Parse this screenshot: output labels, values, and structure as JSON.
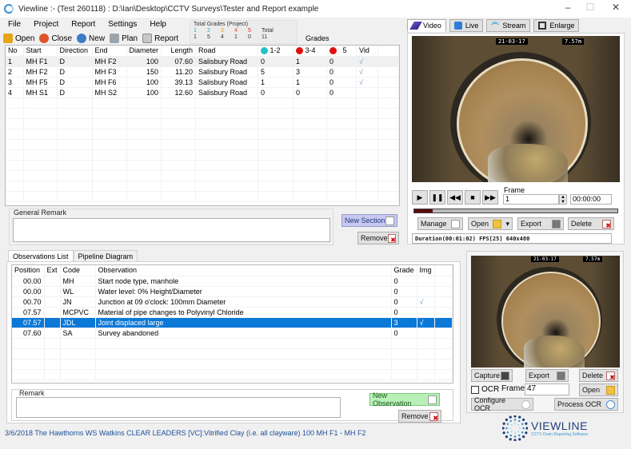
{
  "window": {
    "title": "Viewline :- (Test 260118) : D:\\Ian\\Desktop\\CCTV Surveys\\Tester and Report example",
    "controls": {
      "minimize": "–",
      "maximize": "☐",
      "close": "✕"
    }
  },
  "menu": [
    "File",
    "Project",
    "Report",
    "Settings",
    "Help"
  ],
  "toolbar": [
    {
      "label": "Open",
      "icon": "folder-open-icon",
      "color": "#e8a317"
    },
    {
      "label": "Close",
      "icon": "close-circle-icon",
      "color": "#e0522a"
    },
    {
      "label": "New",
      "icon": "new-globe-icon",
      "color": "#3a7dc9"
    },
    {
      "label": "Plan",
      "icon": "plan-map-icon",
      "color": "#9aa4ad"
    },
    {
      "label": "Report",
      "icon": "report-doc-icon",
      "color": "#8a8a8a"
    }
  ],
  "total_grades": {
    "title": "Total Grades (Project)",
    "headers": [
      "1",
      "2",
      "3",
      "4",
      "5",
      "Total"
    ],
    "header_colors": [
      "#3fa0c8",
      "#29b0c6",
      "#e0a020",
      "#e04848",
      "#e02020",
      "#333333"
    ],
    "values": [
      "1",
      "5",
      "4",
      "1",
      "0",
      "11"
    ]
  },
  "grades_label": "Grades",
  "sections": {
    "columns": [
      "No",
      "Start",
      "Direction",
      "End",
      "Diameter",
      "Length",
      "Road",
      "1-2",
      "3-4",
      "5",
      "Vid"
    ],
    "grade_dot_colors": [
      "#27c0c8",
      "#e01010",
      "#e01010"
    ],
    "rows": [
      {
        "no": "1",
        "start": "MH F1",
        "direction": "D",
        "end": "MH F2",
        "diameter": "100",
        "length": "07.60",
        "road": "Salisbury Road",
        "g12": "0",
        "g34": "1",
        "g5": "0",
        "vid": "√",
        "selected": true
      },
      {
        "no": "2",
        "start": "MH F2",
        "direction": "D",
        "end": "MH F3",
        "diameter": "150",
        "length": "11.20",
        "road": "Salisbury Road",
        "g12": "5",
        "g34": "3",
        "g5": "0",
        "vid": "√",
        "selected": false
      },
      {
        "no": "3",
        "start": "MH F5",
        "direction": "D",
        "end": "MH F6",
        "diameter": "100",
        "length": "39.13",
        "road": "Salisbury Road",
        "g12": "1",
        "g34": "1",
        "g5": "0",
        "vid": "√",
        "selected": false
      },
      {
        "no": "4",
        "start": "MH S1",
        "direction": "D",
        "end": "MH S2",
        "diameter": "100",
        "length": "12.60",
        "road": "Salisbury Road",
        "g12": "0",
        "g34": "0",
        "g5": "0",
        "vid": "",
        "selected": false
      }
    ]
  },
  "general_remark": {
    "label": "General Remark",
    "value": ""
  },
  "section_buttons": {
    "new_section": "New Section",
    "remove": "Remove"
  },
  "obs_tabs": [
    {
      "label": "Observations List",
      "active": true
    },
    {
      "label": "Pipeline Diagram",
      "active": false
    }
  ],
  "observations": {
    "columns": [
      "Position",
      "Ext",
      "Code",
      "Observation",
      "Grade",
      "Img"
    ],
    "rows": [
      {
        "position": "00.00",
        "ext": "",
        "code": "MH",
        "observation": "Start node type, manhole",
        "grade": "0",
        "img": "",
        "selected": false
      },
      {
        "position": "00.00",
        "ext": "",
        "code": "WL",
        "observation": "Water level: 0% Height/Diameter",
        "grade": "0",
        "img": "",
        "selected": false
      },
      {
        "position": "00.70",
        "ext": "",
        "code": "JN",
        "observation": "Junction at  09 o'clock: 100mm Diameter",
        "grade": "0",
        "img": "√",
        "selected": false
      },
      {
        "position": "07.57",
        "ext": "",
        "code": "MCPVC",
        "observation": "Material of pipe changes to Polyvinyl Chloride",
        "grade": "0",
        "img": "",
        "selected": false
      },
      {
        "position": "07.57",
        "ext": "",
        "code": "JDL",
        "observation": "Joint displaced large",
        "grade": "3",
        "img": "√",
        "selected": true
      },
      {
        "position": "07.60",
        "ext": "",
        "code": "SA",
        "observation": "Survey abandoned",
        "grade": "0",
        "img": "",
        "selected": false
      }
    ]
  },
  "remark": {
    "label": "Remark",
    "value": ""
  },
  "observation_buttons": {
    "new_observation": "New Observation",
    "remove": "Remove"
  },
  "status_bar": "3/6/2018  The Hawthorns  WS Watkins  CLEAR LEADERS   [VC]:Vitrified Clay (i.e. all clayware)  100  MH F1 - MH F2",
  "video_tabs": [
    {
      "label": "Video",
      "icon": "video-pen-icon",
      "active": true
    },
    {
      "label": "Live",
      "icon": "live-monitor-icon",
      "active": false
    },
    {
      "label": "Stream",
      "icon": "wifi-stream-icon",
      "active": false
    },
    {
      "label": "Enlarge",
      "icon": "enlarge-icon",
      "active": false
    }
  ],
  "video": {
    "osd_date": "21-03-17",
    "osd_distance": "7.57m",
    "frame_label": "Frame",
    "frame_value": "1",
    "time_value": "00:00:00",
    "progress": 0.09,
    "controls": [
      {
        "name": "play-button",
        "glyph": "▶"
      },
      {
        "name": "pause-button",
        "glyph": "❚❚"
      },
      {
        "name": "rewind-button",
        "glyph": "◀◀"
      },
      {
        "name": "stop-button",
        "glyph": "■"
      },
      {
        "name": "fast-forward-button",
        "glyph": "▶▶"
      }
    ],
    "buttons": {
      "manage": "Manage",
      "open": "Open",
      "export": "Export",
      "delete": "Delete"
    },
    "duration_info": "Duration(00:01:02) FPS[25] 640x480"
  },
  "capture": {
    "osd_date": "21-03-17",
    "osd_distance": "7.57m",
    "buttons": {
      "capture": "Capture",
      "export": "Export",
      "delete": "Delete",
      "open": "Open",
      "configure_ocr": "Configure OCR",
      "process_ocr": "Process OCR"
    },
    "ocr_label": "OCR",
    "ocr_checked": false,
    "frame_label": "Frame",
    "frame_value": "47"
  },
  "logo": {
    "name": "VIEWLINE",
    "tagline": "CCTV Drain Reporting Software"
  }
}
